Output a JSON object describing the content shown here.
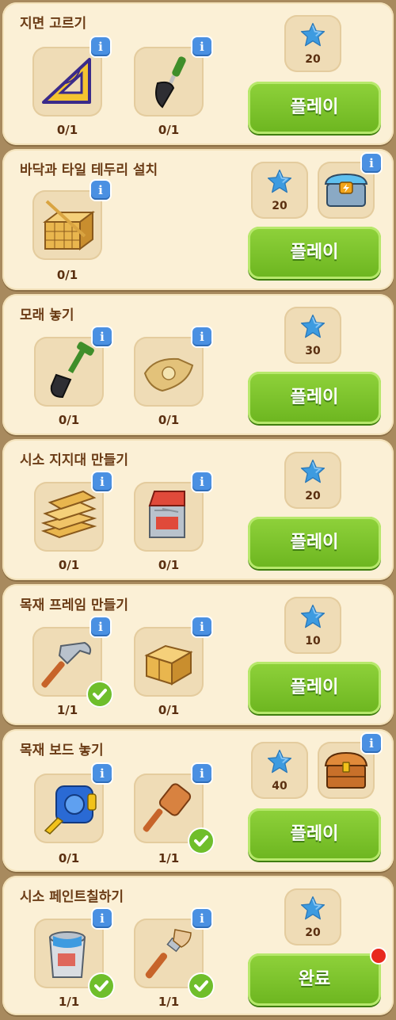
{
  "tasks": [
    {
      "title": "지면 고르기",
      "items": [
        {
          "icon": "triangle-ruler-icon",
          "count": "0/1"
        },
        {
          "icon": "trowel-icon",
          "count": "0/1"
        }
      ],
      "reward_stars": "20",
      "button": "플레이"
    },
    {
      "title": "바닥과 타일 테두리 설치",
      "items": [
        {
          "icon": "lumber-bundle-icon",
          "count": "0/1"
        }
      ],
      "reward_stars": "20",
      "chest": "power-chest-icon",
      "button": "플레이"
    },
    {
      "title": "모래 놓기",
      "items": [
        {
          "icon": "shovel-icon",
          "count": "0/1"
        },
        {
          "icon": "sand-bag-icon",
          "count": "0/1"
        }
      ],
      "reward_stars": "30",
      "button": "플레이"
    },
    {
      "title": "시소 지지대 만들기",
      "items": [
        {
          "icon": "plank-stack-icon",
          "count": "0/1"
        },
        {
          "icon": "nails-box-icon",
          "count": "0/1"
        }
      ],
      "reward_stars": "20",
      "button": "플레이"
    },
    {
      "title": "목재 프레임 만들기",
      "items": [
        {
          "icon": "hammer-icon",
          "count": "1/1",
          "done": true
        },
        {
          "icon": "wood-beams-icon",
          "count": "0/1"
        }
      ],
      "reward_stars": "10",
      "button": "플레이"
    },
    {
      "title": "목재 보드 놓기",
      "items": [
        {
          "icon": "tape-measure-icon",
          "count": "0/1"
        },
        {
          "icon": "mallet-icon",
          "count": "1/1",
          "done": true
        }
      ],
      "reward_stars": "40",
      "chest": "treasure-chest-icon",
      "button": "플레이"
    },
    {
      "title": "시소 페인트칠하기",
      "items": [
        {
          "icon": "paint-can-icon",
          "count": "1/1",
          "done": true
        },
        {
          "icon": "paintbrush-icon",
          "count": "1/1",
          "done": true
        }
      ],
      "reward_stars": "20",
      "button": "완료",
      "notification_dot": true
    }
  ],
  "info_label": "i",
  "colors": {
    "card_bg": "#fbf0d6",
    "title_text": "#6b3c16",
    "button_green": "#7cc42c",
    "star_blue": "#3d9be0",
    "check_green": "#6fbe2b",
    "info_blue": "#4a90e2",
    "notification_red": "#e8281e"
  }
}
